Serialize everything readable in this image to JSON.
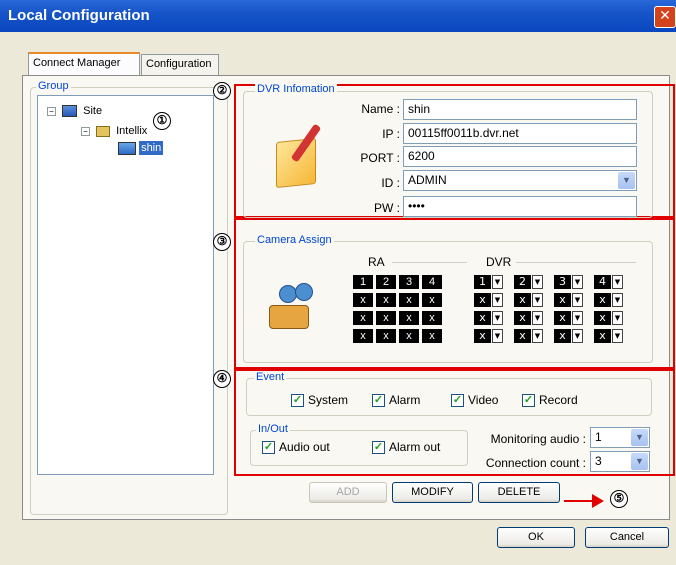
{
  "window": {
    "title": "Local Configuration"
  },
  "tabs": [
    "Connect Manager",
    "Configuration"
  ],
  "group": {
    "label": "Group",
    "tree": {
      "root": "Site",
      "child": "Intellix",
      "leaf": "shin"
    }
  },
  "annotations": [
    "①",
    "②",
    "③",
    "④",
    "⑤"
  ],
  "dvr": {
    "label": "DVR Infomation",
    "fields": [
      {
        "label": "Name :",
        "value": "shin"
      },
      {
        "label": "IP :",
        "value": "00115ff0011b.dvr.net"
      },
      {
        "label": "PORT :",
        "value": "6200"
      },
      {
        "label": "ID :",
        "value": "ADMIN"
      },
      {
        "label": "PW :",
        "value": "••••"
      }
    ]
  },
  "camera": {
    "label": "Camera Assign",
    "ra_label": "RA",
    "dvr_label": "DVR",
    "headers": [
      "1",
      "2",
      "3",
      "4"
    ],
    "empty": "x"
  },
  "event": {
    "label": "Event",
    "checks": [
      "System",
      "Alarm",
      "Video",
      "Record"
    ]
  },
  "inout": {
    "label": "In/Out",
    "checks": [
      "Audio out",
      "Alarm out"
    ],
    "monitoring_label": "Monitoring audio :",
    "monitoring_value": "1",
    "connection_label": "Connection count :",
    "connection_value": "3"
  },
  "buttons": {
    "add": "ADD",
    "modify": "MODIFY",
    "delete": "DELETE",
    "ok": "OK",
    "cancel": "Cancel"
  }
}
